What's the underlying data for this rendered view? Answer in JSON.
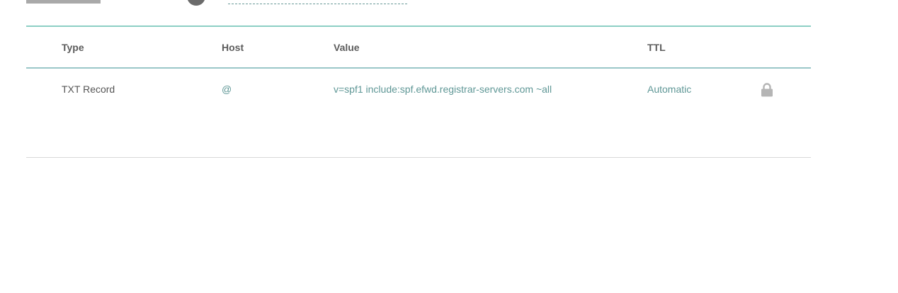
{
  "table": {
    "headers": {
      "type": "Type",
      "host": "Host",
      "value": "Value",
      "ttl": "TTL"
    },
    "rows": [
      {
        "type": "TXT Record",
        "host": "@",
        "value": "v=spf1 include:spf.efwd.registrar-servers.com ~all",
        "ttl": "Automatic",
        "icon": "lock-icon"
      }
    ]
  },
  "colors": {
    "accent": "#5f9796",
    "header_border": "#8ccfc4",
    "text": "#555555",
    "icon": "#b5b5b5"
  }
}
